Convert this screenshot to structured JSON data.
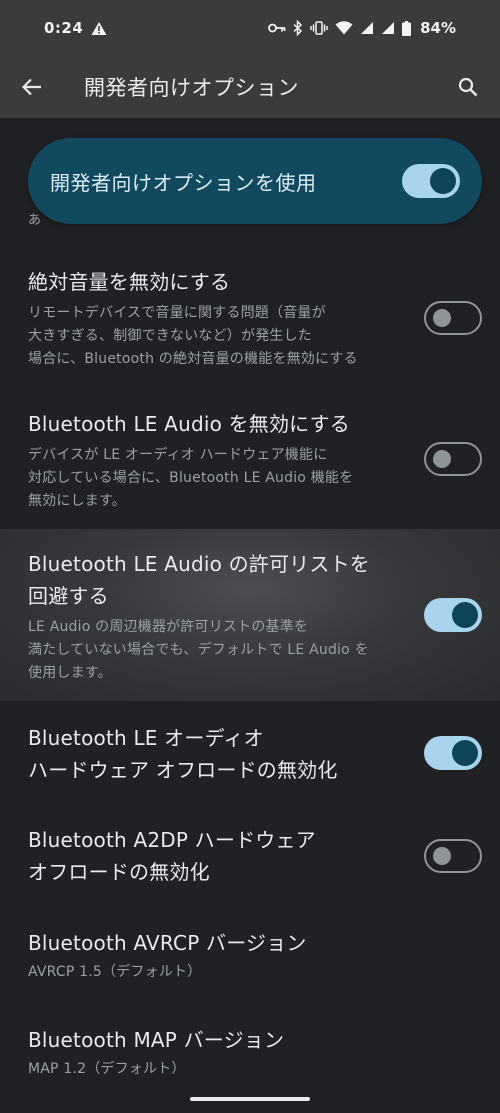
{
  "status_bar": {
    "time": "0:24",
    "battery": "84%"
  },
  "app_bar": {
    "title": "開発者向けオプション"
  },
  "main_toggle": {
    "label": "開発者向けオプションを使用",
    "on": true
  },
  "peek_text": "あ",
  "settings": [
    {
      "title_lines": [
        "絶対音量を無効にする"
      ],
      "desc_lines": [
        "リモートデバイスで音量に関する問題（音量が",
        "大きすぎる、制御できないなど）が発生した",
        "場合に、Bluetooth の絶対音量の機能を無効にする"
      ],
      "on": false
    },
    {
      "title_lines": [
        "Bluetooth LE Audio を無効にする"
      ],
      "desc_lines": [
        "デバイスが LE オーディオ ハードウェア機能に",
        "対応している場合に、Bluetooth LE Audio 機能を",
        "無効にします。"
      ],
      "on": false
    },
    {
      "title_lines": [
        "Bluetooth LE Audio の許可リストを",
        "回避する"
      ],
      "desc_lines": [
        "LE Audio の周辺機器が許可リストの基準を",
        "満たしていない場合でも、デフォルトで LE Audio を",
        "使用します。"
      ],
      "on": true,
      "highlighted": true
    },
    {
      "title_lines": [
        "Bluetooth LE オーディオ",
        "ハードウェア オフロードの無効化"
      ],
      "desc_lines": [],
      "on": true
    },
    {
      "title_lines": [
        "Bluetooth A2DP ハードウェア",
        "オフロードの無効化"
      ],
      "desc_lines": [],
      "on": false
    },
    {
      "title_lines": [
        "Bluetooth AVRCP バージョン"
      ],
      "desc_lines": [
        "AVRCP 1.5（デフォルト）"
      ]
    },
    {
      "title_lines": [
        "Bluetooth MAP バージョン"
      ],
      "desc_lines": [
        "MAP 1.2（デフォルト）"
      ]
    }
  ],
  "icons": {
    "back": "arrow-back-icon",
    "search": "search-icon",
    "warning": "warning-icon",
    "vpn_key": "key-icon",
    "bluetooth": "bluetooth-icon",
    "vibrate": "vibrate-icon",
    "wifi": "wifi-icon",
    "signal": "signal-icon",
    "battery": "battery-icon"
  },
  "colors": {
    "background": "#202124",
    "app_bar": "#3a3b3d",
    "main_card": "#13495e",
    "switch_on_track": "#a8d4ee",
    "switch_on_thumb": "#0f4357",
    "switch_off": "#8f9499"
  }
}
